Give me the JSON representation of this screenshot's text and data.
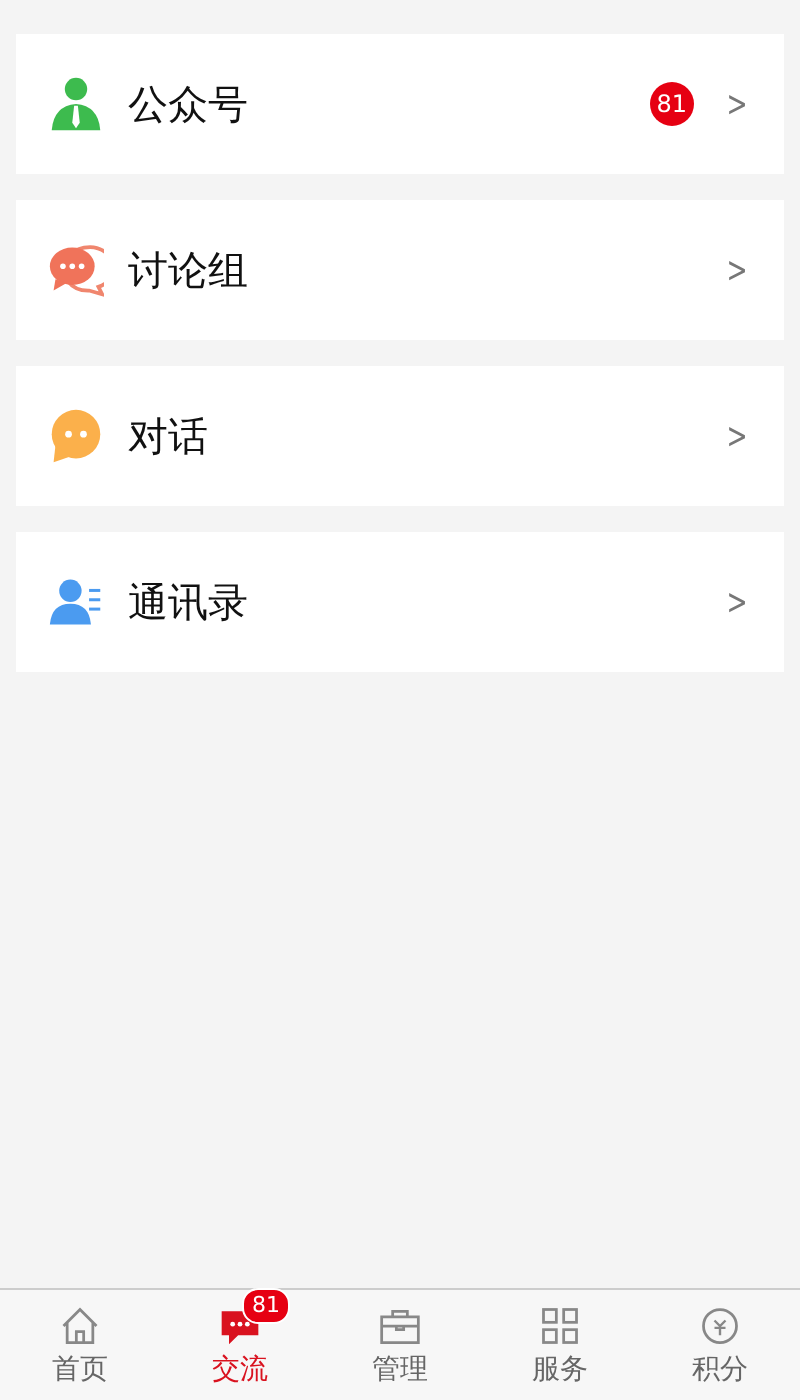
{
  "menu": [
    {
      "kind": "official",
      "label": "公众号",
      "badge": "81",
      "chevron": ">"
    },
    {
      "kind": "group",
      "label": "讨论组",
      "chevron": ">"
    },
    {
      "kind": "chat",
      "label": "对话",
      "chevron": ">"
    },
    {
      "kind": "contacts",
      "label": "通讯录",
      "chevron": ">"
    }
  ],
  "tab_bar": [
    {
      "kind": "home",
      "label": "首页",
      "selected": false
    },
    {
      "kind": "chat",
      "label": "交流",
      "selected": true,
      "badge": "81"
    },
    {
      "kind": "manage",
      "label": "管理",
      "selected": false
    },
    {
      "kind": "service",
      "label": "服务",
      "selected": false
    },
    {
      "kind": "points",
      "label": "积分",
      "selected": false
    }
  ]
}
